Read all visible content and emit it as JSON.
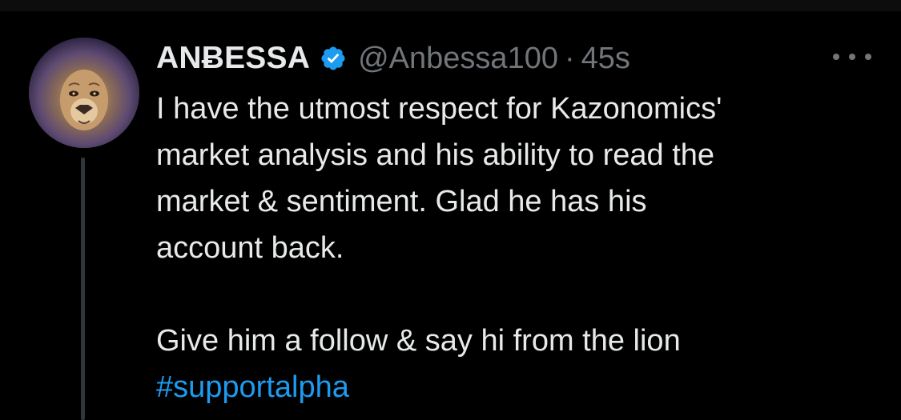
{
  "tweet": {
    "display_name": "ANɃESSA",
    "handle": "@Anbessa100",
    "separator": "·",
    "time": "45s",
    "lines": [
      "I have the utmost respect for Kazonomics'",
      "market analysis and his ability to read the",
      "market & sentiment. Glad he has his",
      "account back."
    ],
    "line2": "Give him a follow & say hi from the lion",
    "hashtag": "#supportalpha"
  },
  "icons": {
    "verified": "verified-badge-icon",
    "more": "more-options-icon",
    "avatar": "lion-avatar"
  },
  "colors": {
    "background": "#000000",
    "text": "#e7e9ea",
    "muted": "#71767b",
    "accent": "#1d9bf0",
    "thread_line": "#333639"
  }
}
